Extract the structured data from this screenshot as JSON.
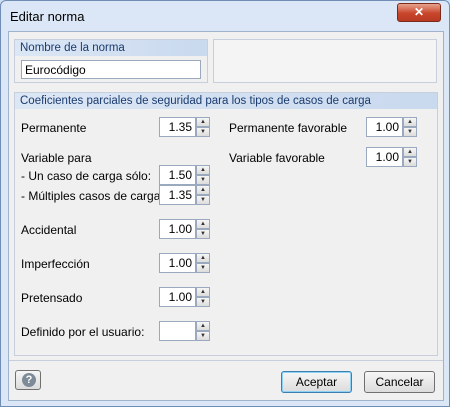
{
  "window": {
    "title": "Editar norma",
    "close_glyph": "✕"
  },
  "norm_name": {
    "header": "Nombre de la norma",
    "value": "Eurocódigo"
  },
  "coefficients": {
    "header": "Coeficientes parciales de seguridad para los tipos de casos de carga",
    "permanente": {
      "label": "Permanente",
      "value": "1.35"
    },
    "permanente_favorable": {
      "label": "Permanente favorable",
      "value": "1.00"
    },
    "variable_para": {
      "label": "Variable para"
    },
    "un_caso": {
      "label": "- Un caso de carga sólo:",
      "value": "1.50"
    },
    "multiples": {
      "label": "- Múltiples casos de carga:",
      "value": "1.35"
    },
    "variable_favorable": {
      "label": "Variable favorable",
      "value": "1.00"
    },
    "accidental": {
      "label": "Accidental",
      "value": "1.00"
    },
    "imperfeccion": {
      "label": "Imperfección",
      "value": "1.00"
    },
    "pretensado": {
      "label": "Pretensado",
      "value": "1.00"
    },
    "definido_usuario": {
      "label": "Definido por el usuario:",
      "value": ""
    }
  },
  "buttons": {
    "help_glyph": "?",
    "accept": "Aceptar",
    "cancel": "Cancelar"
  },
  "icons": {
    "help": "help-icon",
    "close": "close-icon",
    "spin_up": "▲",
    "spin_down": "▼"
  }
}
